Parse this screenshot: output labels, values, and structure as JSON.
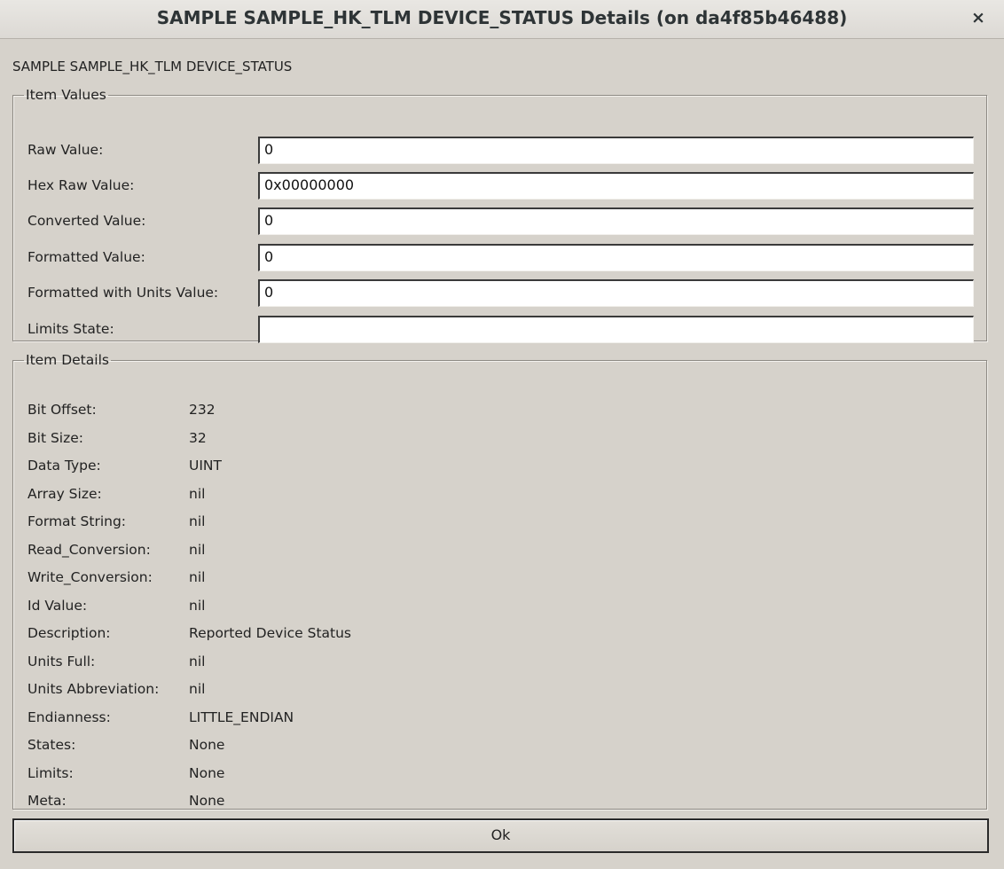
{
  "window": {
    "title": "SAMPLE SAMPLE_HK_TLM DEVICE_STATUS Details (on da4f85b46488)",
    "close_glyph": "×"
  },
  "item_name": "SAMPLE SAMPLE_HK_TLM DEVICE_STATUS",
  "item_values": {
    "legend": "Item Values",
    "rows": [
      {
        "label": "Raw Value:",
        "value": "0"
      },
      {
        "label": "Hex Raw Value:",
        "value": "0x00000000"
      },
      {
        "label": "Converted Value:",
        "value": "0"
      },
      {
        "label": "Formatted Value:",
        "value": "0"
      },
      {
        "label": "Formatted with Units Value:",
        "value": "0"
      },
      {
        "label": "Limits State:",
        "value": ""
      }
    ]
  },
  "item_details": {
    "legend": "Item Details",
    "rows": [
      {
        "label": "Bit Offset:",
        "value": "232"
      },
      {
        "label": "Bit Size:",
        "value": "32"
      },
      {
        "label": "Data Type:",
        "value": "UINT"
      },
      {
        "label": "Array Size:",
        "value": "nil"
      },
      {
        "label": "Format String:",
        "value": "nil"
      },
      {
        "label": "Read_Conversion:",
        "value": "nil"
      },
      {
        "label": "Write_Conversion:",
        "value": "nil"
      },
      {
        "label": "Id Value:",
        "value": "nil"
      },
      {
        "label": "Description:",
        "value": "Reported Device Status"
      },
      {
        "label": "Units Full:",
        "value": "nil"
      },
      {
        "label": "Units Abbreviation:",
        "value": "nil"
      },
      {
        "label": "Endianness:",
        "value": "LITTLE_ENDIAN"
      },
      {
        "label": "States:",
        "value": "None"
      },
      {
        "label": "Limits:",
        "value": "None"
      },
      {
        "label": "Meta:",
        "value": "None"
      }
    ]
  },
  "buttons": {
    "ok_label": "Ok"
  }
}
